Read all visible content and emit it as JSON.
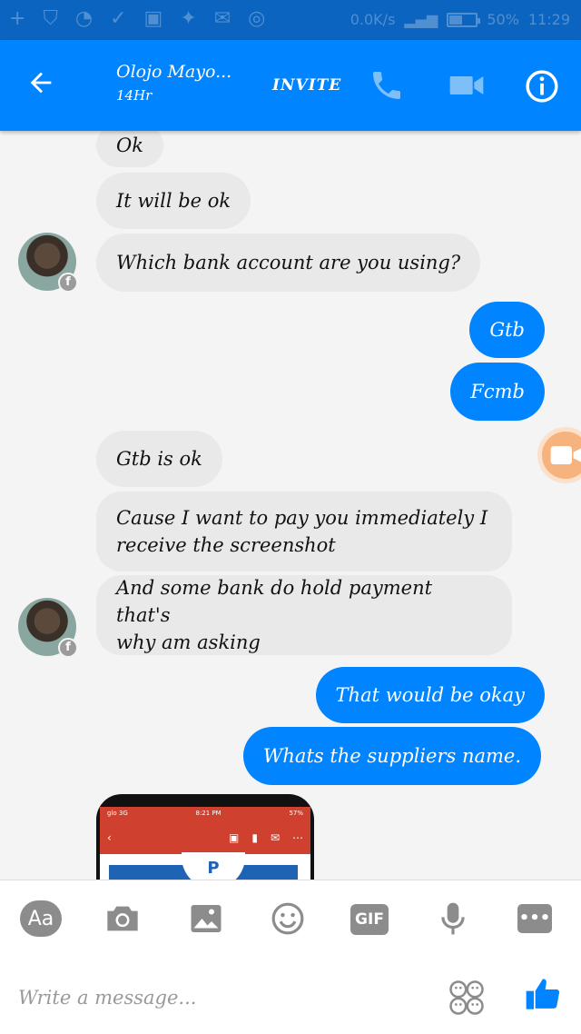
{
  "status_bar": {
    "left_icons": "+ ⛉ ◔ ✓ ▣ ✦ ✉ ◎",
    "data_speed": "0.0K/s",
    "battery_percent": "50%",
    "battery_level": 0.5,
    "time": "11:29"
  },
  "header": {
    "contact_name": "Olojo Mayo...",
    "contact_status": "14Hr",
    "invite_label": "INVITE"
  },
  "messages": [
    {
      "side": "in",
      "text": "Ok"
    },
    {
      "side": "in",
      "text": "It will be ok"
    },
    {
      "side": "in",
      "text": "Which bank account are you using?"
    },
    {
      "side": "out",
      "text": "Gtb"
    },
    {
      "side": "out",
      "text": "Fcmb"
    },
    {
      "side": "in",
      "text": "Gtb is ok"
    },
    {
      "side": "in",
      "line1": "Cause I want to pay you immediately I",
      "line2": "receive the screenshot"
    },
    {
      "side": "in",
      "line1": "And some bank do hold payment that's",
      "line2": "why am asking"
    },
    {
      "side": "out",
      "text": "That would be okay"
    },
    {
      "side": "out",
      "text": "Whats the suppliers name."
    }
  ],
  "attachment": {
    "carrier": "glo 3G",
    "time": "8:21 PM",
    "battery": "57%",
    "logo": "P"
  },
  "toolbar": {
    "aa_label": "Aa",
    "gif_label": "GIF",
    "more_label": "•••"
  },
  "composer": {
    "placeholder": "Write a message..."
  },
  "colors": {
    "accent": "#0084ff",
    "incoming_bubble": "#e9e9e9",
    "status_bar": "#0b64bf"
  }
}
